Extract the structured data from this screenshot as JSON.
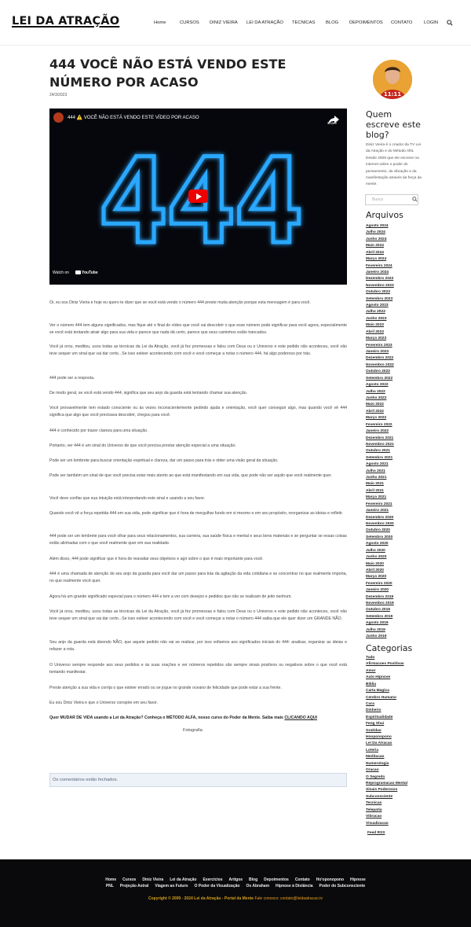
{
  "header": {
    "logo": "LEI DA ATRAÇÃO",
    "nav": [
      "Home",
      "CURSOS",
      "DINIZ VIEIRA",
      "LEI DA ATRAÇÃO",
      "TECNICAS",
      "BLOG",
      "DEPOIMENTOS",
      "CONTATO",
      "LOGIN"
    ]
  },
  "post": {
    "title": "444 VOCÊ NÃO ESTÁ VENDO ESTE NÚMERO POR ACASO",
    "date": "24/3/2023",
    "video": {
      "title": "444 ⚠️ VOCÊ NÃO ESTÁ VENDO ESTE VÍDEO POR ACASO",
      "share": "Share",
      "watch_on": "Watch on",
      "youtube": "YouTube",
      "digits": "444"
    },
    "paragraphs": [
      "Oi, eu sou Diniz Vieira e hoje eu quero te dizer que se você está vendo o número 444 preste muita atenção porque esta mensagem é para você.",
      "Ver o número 444 tem alguns significados, mas fique até o final do vídeo que você vai descobrir o que esse número pode significar para você agora, especialmente se você está tentando atrair algo para sua vida e parece que nada dá certo, parece que seus caminhos estão trancados.",
      "Você já orou, meditou, usou todas as técnicas da Lei da Atração, você já fez promessas e falou com Deus ou o Universo e este pedido não aconteceu, você não teve sequer um sinal que vai dar certo...Se isso estiver acontecendo com você e você começar a notar o número 444, há algo poderoso por trás.",
      "444 pode ser a resposta.",
      "De modo geral, se você está vendo 444, significa que seu anjo da guarda está tentando chamar sua atenção.",
      "Você provavelmente tem estado consciente ou às vezes inconscientemente pedindo ajuda e orientação, você quer conseguir algo, mas quando você vê 444 significa que algo que você precisava descobrir, chegou para você.",
      "444 é conhecido por trazer clareza para uma situação.",
      "Portanto, ver 444 é um sinal do Universo de que você precisa prestar atenção especial a uma situação.",
      "Pode ser um lembrete para buscar orientação espiritual e clareza, dar um passo para trás e obter uma visão geral da situação.",
      "Pode ser também um sinal de que você precisa estar mais atento ao que está manifestando em sua vida, que pode não ser aquilo que você realmente quer.",
      "Você deve confiar que sua intuição está interpretando este sinal e usando a seu favor.",
      "Quando você vê a força repetida 444 em sua vida, pode significar que é hora de mergulhar fundo em si mesmo e em seu propósito, reorganizar as ideias e refletir.",
      "444 pode ser um lembrete para você olhar para seus relacionamentos, sua carreira, sua saúde física e mental e seus bens materiais e se perguntar se essas coisas estão alinhadas com o que você realmente quer em sua realidade.",
      "Além disso, 444 pode significar que é hora de reavaliar seus objetivos e agir sobre o que é mais importante para você.",
      "444 é uma chamada de atenção do seu anjo da guarda para você dar um passo para trás da agitação da vida cotidiana e se concentrar no que realmente importa, no que realmente você quer.",
      "Agora há um grande significado especial para o número 444 e tem a ver com desejos e pedidos que não se realizam de jeito nenhum.",
      "Você já orou, meditou, usou todas as técnicas da Lei da Atração, você já fez promessas e falou com Deus ou o Universo e este pedido não aconteceu, você não teve sequer um sinal que vai dar certo...Se isso estiver acontecendo com você e você começar a notar o número 444 saiba que ele quer dizer um GRANDE NÃO.",
      "Seu anjo da guarda está dizendo NÃO, que aquele pedido não vai se realizar, por isso voltamos aos significados iniciais do 444: analisar, organizar as ideias e refazer a rota.",
      "O Universo sempre responde aos seus pedidos e às suas orações e ver números repetidos são sempre sinais positivos ou negativos sobre o que você está tentando manifestar.",
      "Preste atenção a sua vida e corrija o que estiver errado ou se jogue no grande oceano de felicidade que pode estar a sua frente.",
      "Eu sou Diniz Vieira e que o Universo conspire em seu favor."
    ],
    "cta_text": "Quer MUDAR DE VIDA usando a Lei da Atração? Conheça o MÉTODO ALFA, nosso curso do Poder da Mente. Saiba mais ",
    "cta_link": "CLICANDO AQUI",
    "image_alt": "Fotografia",
    "comments_closed": "Os comentários estão fechados."
  },
  "sidebar": {
    "author_heading": "Quem escreve este blog?",
    "author_text": "Diniz Vieira é o criador da TV Lei da Atração e do Método Alfa. Desde 2009 que ele escreve na internet sobre o poder do pensamento, da vibração e da manifestação através da força da mente.",
    "search_placeholder": "Busca",
    "archives_heading": "Arquivos",
    "archives": [
      "Agosto 2024",
      "Julho 2024",
      "Junho 2024",
      "Maio 2024",
      "Abril 2024",
      "Março 2024",
      "Fevereiro 2024",
      "Janeiro 2024",
      "Dezembro 2023",
      "Novembro 2023",
      "Outubro 2023",
      "Setembro 2023",
      "Agosto 2023",
      "Julho 2023",
      "Junho 2023",
      "Maio 2023",
      "Abril 2023",
      "Março 2023",
      "Fevereiro 2023",
      "Janeiro 2023",
      "Dezembro 2022",
      "Novembro 2022",
      "Outubro 2022",
      "Setembro 2022",
      "Agosto 2022",
      "Julho 2022",
      "Junho 2022",
      "Maio 2022",
      "Abril 2022",
      "Março 2022",
      "Fevereiro 2022",
      "Janeiro 2022",
      "Dezembro 2021",
      "Novembro 2021",
      "Outubro 2021",
      "Setembro 2021",
      "Agosto 2021",
      "Julho 2021",
      "Junho 2021",
      "Maio 2021",
      "Abril 2021",
      "Março 2021",
      "Fevereiro 2021",
      "Janeiro 2021",
      "Dezembro 2020",
      "Novembro 2020",
      "Outubro 2020",
      "Setembro 2020",
      "Agosto 2020",
      "Julho 2020",
      "Junho 2020",
      "Maio 2020",
      "Abril 2020",
      "Março 2020",
      "Fevereiro 2020",
      "Janeiro 2020",
      "Dezembro 2019",
      "Novembro 2019",
      "Outubro 2019",
      "Setembro 2019",
      "Agosto 2019",
      "Julho 2019",
      "Junho 2019"
    ],
    "categories_heading": "Categorias",
    "categories": [
      "Tudo",
      "Afirmacoes Positivas",
      "Amor",
      "Auto Hipnose",
      "Biblia",
      "Carta Magica",
      "Cerebro Humano",
      "Cura",
      "Dinheiro",
      "Espiritualidade",
      "Feng Shui",
      "Gratidao",
      "Hooponopono",
      "Lei Da Atracao",
      "Loteria",
      "Meditacao",
      "Numerologia",
      "Oracao",
      "O Segredo",
      "Reprogramacao Mental",
      "Sinais Poderosos",
      "Subconsciente",
      "Tecnicas",
      "Telepatia",
      "Vibracao",
      "Visualizacao"
    ],
    "feed": "Feed RSS"
  },
  "footer": {
    "row1": [
      "Home",
      "Cursos",
      "Diniz Vieira",
      "Lei da Atração",
      "Exercícios",
      "Artigos",
      "Blog",
      "Depoimentos",
      "Contato",
      "Ho'oponopono",
      "Hipnose"
    ],
    "row2": [
      "PNL",
      "Projeção Astral",
      "Viagem ao Futuro",
      "O Poder da Visualização",
      "Os Abraham",
      "Hipnose à Distância",
      "Poder do Subconsciente"
    ],
    "copyright": "Copyright © 2009 - 2024 Lei da Atração - Portal da Mente",
    "contact": " Fale conosco: contato@leidaatracao.tv"
  },
  "colors": {
    "accent": "#d4a017",
    "video_bg": "#06070c",
    "digit_glow": "#2ba8ff",
    "footer_bg": "#0a0a0c"
  }
}
